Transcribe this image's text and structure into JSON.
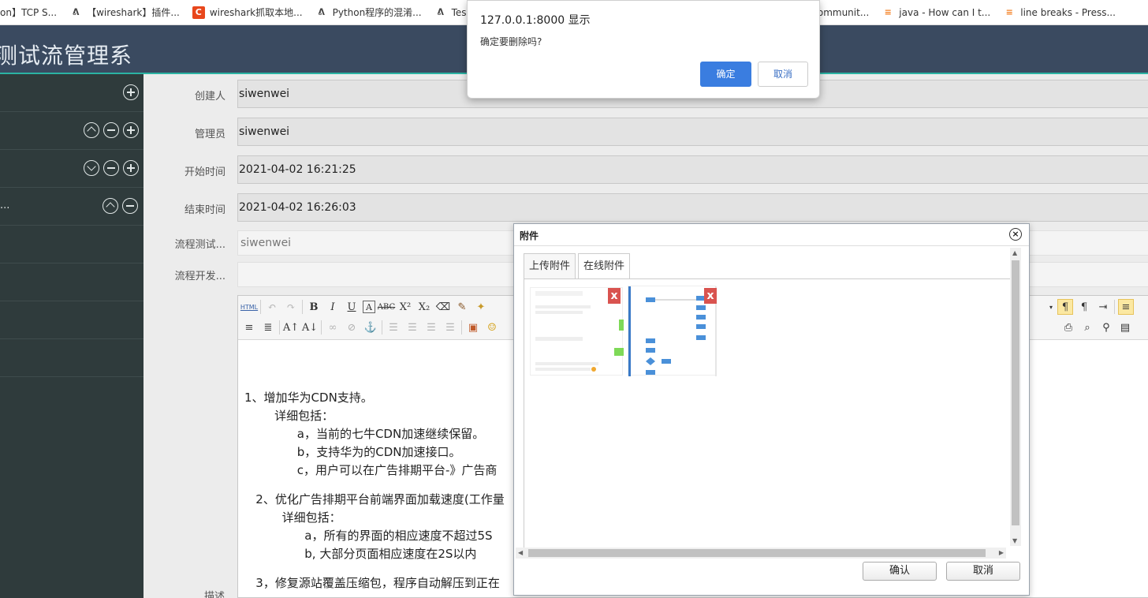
{
  "bookmarks": [
    {
      "icon": "cursor-icon",
      "label": "on】TCP S..."
    },
    {
      "icon": "wireshark-icon",
      "label": "【wireshark】插件..."
    },
    {
      "icon": "csdn-icon",
      "label": "wireshark抓取本地..."
    },
    {
      "icon": "wireshark-icon",
      "label": "Python程序的混淆..."
    },
    {
      "icon": "wireshark-icon",
      "label": "Tes"
    },
    {
      "icon": "eclipse-icon",
      "label": "Eclipse Communit..."
    },
    {
      "icon": "stackoverflow-icon",
      "label": "java - How can I t..."
    },
    {
      "icon": "stackoverflow-icon",
      "label": "line breaks - Press..."
    }
  ],
  "app": {
    "title": "测试流管理系"
  },
  "sidebar": {
    "items": [
      {
        "label": ""
      },
      {
        "label": ""
      },
      {
        "label": ""
      },
      {
        "label": "..."
      },
      {
        "label": ""
      },
      {
        "label": ""
      },
      {
        "label": ""
      },
      {
        "label": ""
      }
    ]
  },
  "form": {
    "creator_label": "创建人",
    "creator_value": "siwenwei",
    "manager_label": "管理员",
    "manager_value": "siwenwei",
    "start_label": "开始时间",
    "start_value": "2021-04-02 16:21:25",
    "end_label": "结束时间",
    "end_value": "2021-04-02 16:26:03",
    "flow_test_label": "流程测试...",
    "flow_test_value": "siwenwei",
    "flow_dev_label": "流程开发...",
    "flow_dev_value": "",
    "desc_label": "描述"
  },
  "editor": {
    "html_label": "HTML",
    "lines": [
      "1、增加华为CDN支持。",
      "        详细包括：",
      "              a，当前的七牛CDN加速继续保留。",
      "              b，支持华为的CDN加速接口。",
      "              c，用户可以在广告排期平台-》广告商",
      "",
      "   2、优化广告排期平台前端界面加载速度(工作量",
      "          详细包括：",
      "                a，所有的界面的相应速度不超过5S",
      "                b, 大部分页面相应速度在2S以内",
      "",
      "   3，修复源站覆盖压缩包，程序自动解压到正在"
    ]
  },
  "attach": {
    "title": "附件",
    "tabs": [
      "上传附件",
      "在线附件"
    ],
    "delete_mark": "x",
    "confirm": "确认",
    "cancel": "取消"
  },
  "alert": {
    "title": "127.0.0.1:8000 显示",
    "message": "确定要删除吗?",
    "ok": "确定",
    "cancel": "取消"
  },
  "colors": {
    "header": "#3a4a60",
    "sidebar": "#2f3b3c",
    "accent": "#2bb3a3",
    "alert_ok": "#3a7de0",
    "delete": "#d9534f"
  }
}
